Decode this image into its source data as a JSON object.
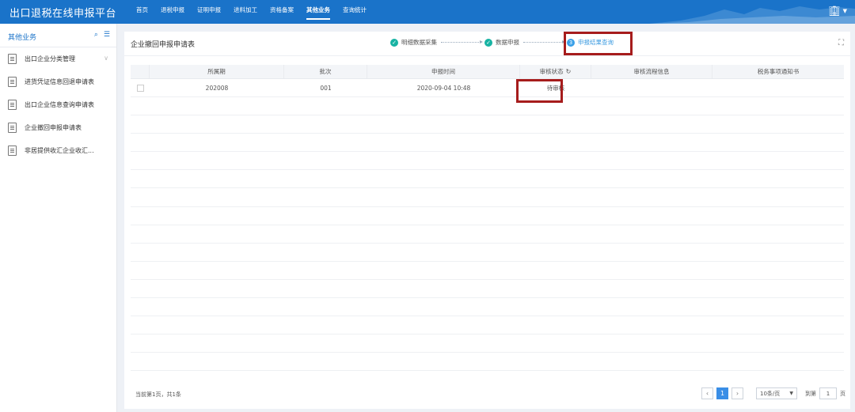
{
  "header": {
    "brand": "出口退税在线申报平台",
    "nav": [
      "首页",
      "退税申报",
      "证明申报",
      "进料加工",
      "资格备案",
      "其他业务",
      "查询统计"
    ],
    "active_nav": "其他业务",
    "right_icon": "building-icon"
  },
  "sidebar": {
    "title": "其他业务",
    "items": [
      {
        "label": "出口企业分类管理",
        "icon": "doc-icon",
        "expandable": true
      },
      {
        "label": "进货凭证信息回退申请表",
        "icon": "doc-refresh-icon"
      },
      {
        "label": "出口企业信息查询申请表",
        "icon": "doc-search-icon"
      },
      {
        "label": "企业撤回申报申请表",
        "icon": "doc-chart-icon"
      },
      {
        "label": "非居提供收汇企业收汇...",
        "icon": "doc-list-icon"
      }
    ]
  },
  "panel": {
    "title": "企业撤回申报申请表",
    "steps": [
      {
        "label": "明细数据采集",
        "state": "done"
      },
      {
        "label": "数据申报",
        "state": "done"
      },
      {
        "label": "申报结果查询",
        "state": "current",
        "num": "3"
      }
    ]
  },
  "table": {
    "columns": [
      "",
      "所属期",
      "批次",
      "申报时间",
      "审核状态",
      "审核流程信息",
      "税务事项通知书"
    ],
    "rows": [
      {
        "period": "202008",
        "batch": "001",
        "time": "2020-09-04 10:48",
        "status": "待审核",
        "flow": "",
        "notice": ""
      }
    ]
  },
  "footer": {
    "info": "当前第1页，共1条",
    "current_page": "1",
    "page_size": "10条/页",
    "goto_label": "到第",
    "goto_value": "1",
    "page_unit": "页"
  },
  "colors": {
    "primary": "#1a73c9",
    "highlight": "#a61c1c",
    "step_done": "#17b3a3"
  }
}
